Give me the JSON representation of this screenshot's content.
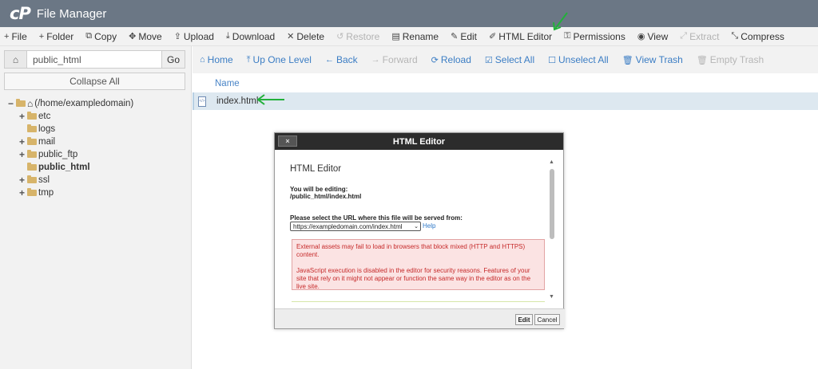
{
  "app": {
    "logo": "cP",
    "title": "File Manager"
  },
  "toolbar": [
    {
      "icon": "+",
      "label": "File",
      "disabled": false
    },
    {
      "icon": "+",
      "label": "Folder",
      "disabled": false
    },
    {
      "icon": "⧉",
      "label": "Copy",
      "disabled": false
    },
    {
      "icon": "✥",
      "label": "Move",
      "disabled": false
    },
    {
      "icon": "⇪",
      "label": "Upload",
      "disabled": false
    },
    {
      "icon": "⤓",
      "label": "Download",
      "disabled": false
    },
    {
      "icon": "✕",
      "label": "Delete",
      "disabled": false
    },
    {
      "icon": "↺",
      "label": "Restore",
      "disabled": true
    },
    {
      "icon": "▤",
      "label": "Rename",
      "disabled": false
    },
    {
      "icon": "✎",
      "label": "Edit",
      "disabled": false
    },
    {
      "icon": "✐",
      "label": "HTML Editor",
      "disabled": false
    },
    {
      "icon": "⚿",
      "label": "Permissions",
      "disabled": false
    },
    {
      "icon": "◉",
      "label": "View",
      "disabled": false
    },
    {
      "icon": "⤢",
      "label": "Extract",
      "disabled": true
    },
    {
      "icon": "⤡",
      "label": "Compress",
      "disabled": false
    }
  ],
  "sidebar": {
    "path_value": "public_html",
    "go_label": "Go",
    "collapse_label": "Collapse All",
    "tree": [
      {
        "toggle": "−",
        "label": "(/home/exampledomain)",
        "indent": 0,
        "home": true,
        "bold": false
      },
      {
        "toggle": "+",
        "label": "etc",
        "indent": 1,
        "home": false,
        "bold": false
      },
      {
        "toggle": "",
        "label": "logs",
        "indent": 1,
        "home": false,
        "bold": false
      },
      {
        "toggle": "+",
        "label": "mail",
        "indent": 1,
        "home": false,
        "bold": false
      },
      {
        "toggle": "+",
        "label": "public_ftp",
        "indent": 1,
        "home": false,
        "bold": false
      },
      {
        "toggle": "",
        "label": "public_html",
        "indent": 1,
        "home": false,
        "bold": true
      },
      {
        "toggle": "+",
        "label": "ssl",
        "indent": 1,
        "home": false,
        "bold": false
      },
      {
        "toggle": "+",
        "label": "tmp",
        "indent": 1,
        "home": false,
        "bold": false
      }
    ]
  },
  "actionbar": [
    {
      "icon": "⌂",
      "label": "Home",
      "disabled": false
    },
    {
      "icon": "⤒",
      "label": "Up One Level",
      "disabled": false
    },
    {
      "icon": "←",
      "label": "Back",
      "disabled": false
    },
    {
      "icon": "→",
      "label": "Forward",
      "disabled": true
    },
    {
      "icon": "⟳",
      "label": "Reload",
      "disabled": false
    },
    {
      "icon": "☑",
      "label": "Select All",
      "disabled": false
    },
    {
      "icon": "☐",
      "label": "Unselect All",
      "disabled": false
    },
    {
      "icon": "🗑",
      "label": "View Trash",
      "disabled": false
    },
    {
      "icon": "🗑",
      "label": "Empty Trash",
      "disabled": true
    }
  ],
  "file_list": {
    "column_name": "Name",
    "file_icon_text": "</>",
    "rows": [
      {
        "name": "index.html"
      }
    ]
  },
  "modal": {
    "close_label": "×",
    "title": "HTML Editor",
    "heading": "HTML Editor",
    "editing_label": "You will be editing:",
    "editing_path": "/public_html/index.html",
    "select_label": "Please select the URL where this file will be served from:",
    "select_value": "https://exampledomain.com/index.html",
    "help_label": "Help",
    "warning_1": "External assets may fail to load in browsers that block mixed (HTTP and HTTPS) content.",
    "warning_2": "JavaScript execution is disabled in the editor for security reasons. Features of your site that rely on it might not appear or function the same way in the editor as on the live site.",
    "edit_label": "Edit",
    "cancel_label": "Cancel"
  },
  "colors": {
    "titlebar": "#6b7785",
    "link": "#3b7dc4",
    "arrow": "#22b03a",
    "warning_text": "#c62a2a",
    "warning_bg": "#fbe3e3"
  }
}
